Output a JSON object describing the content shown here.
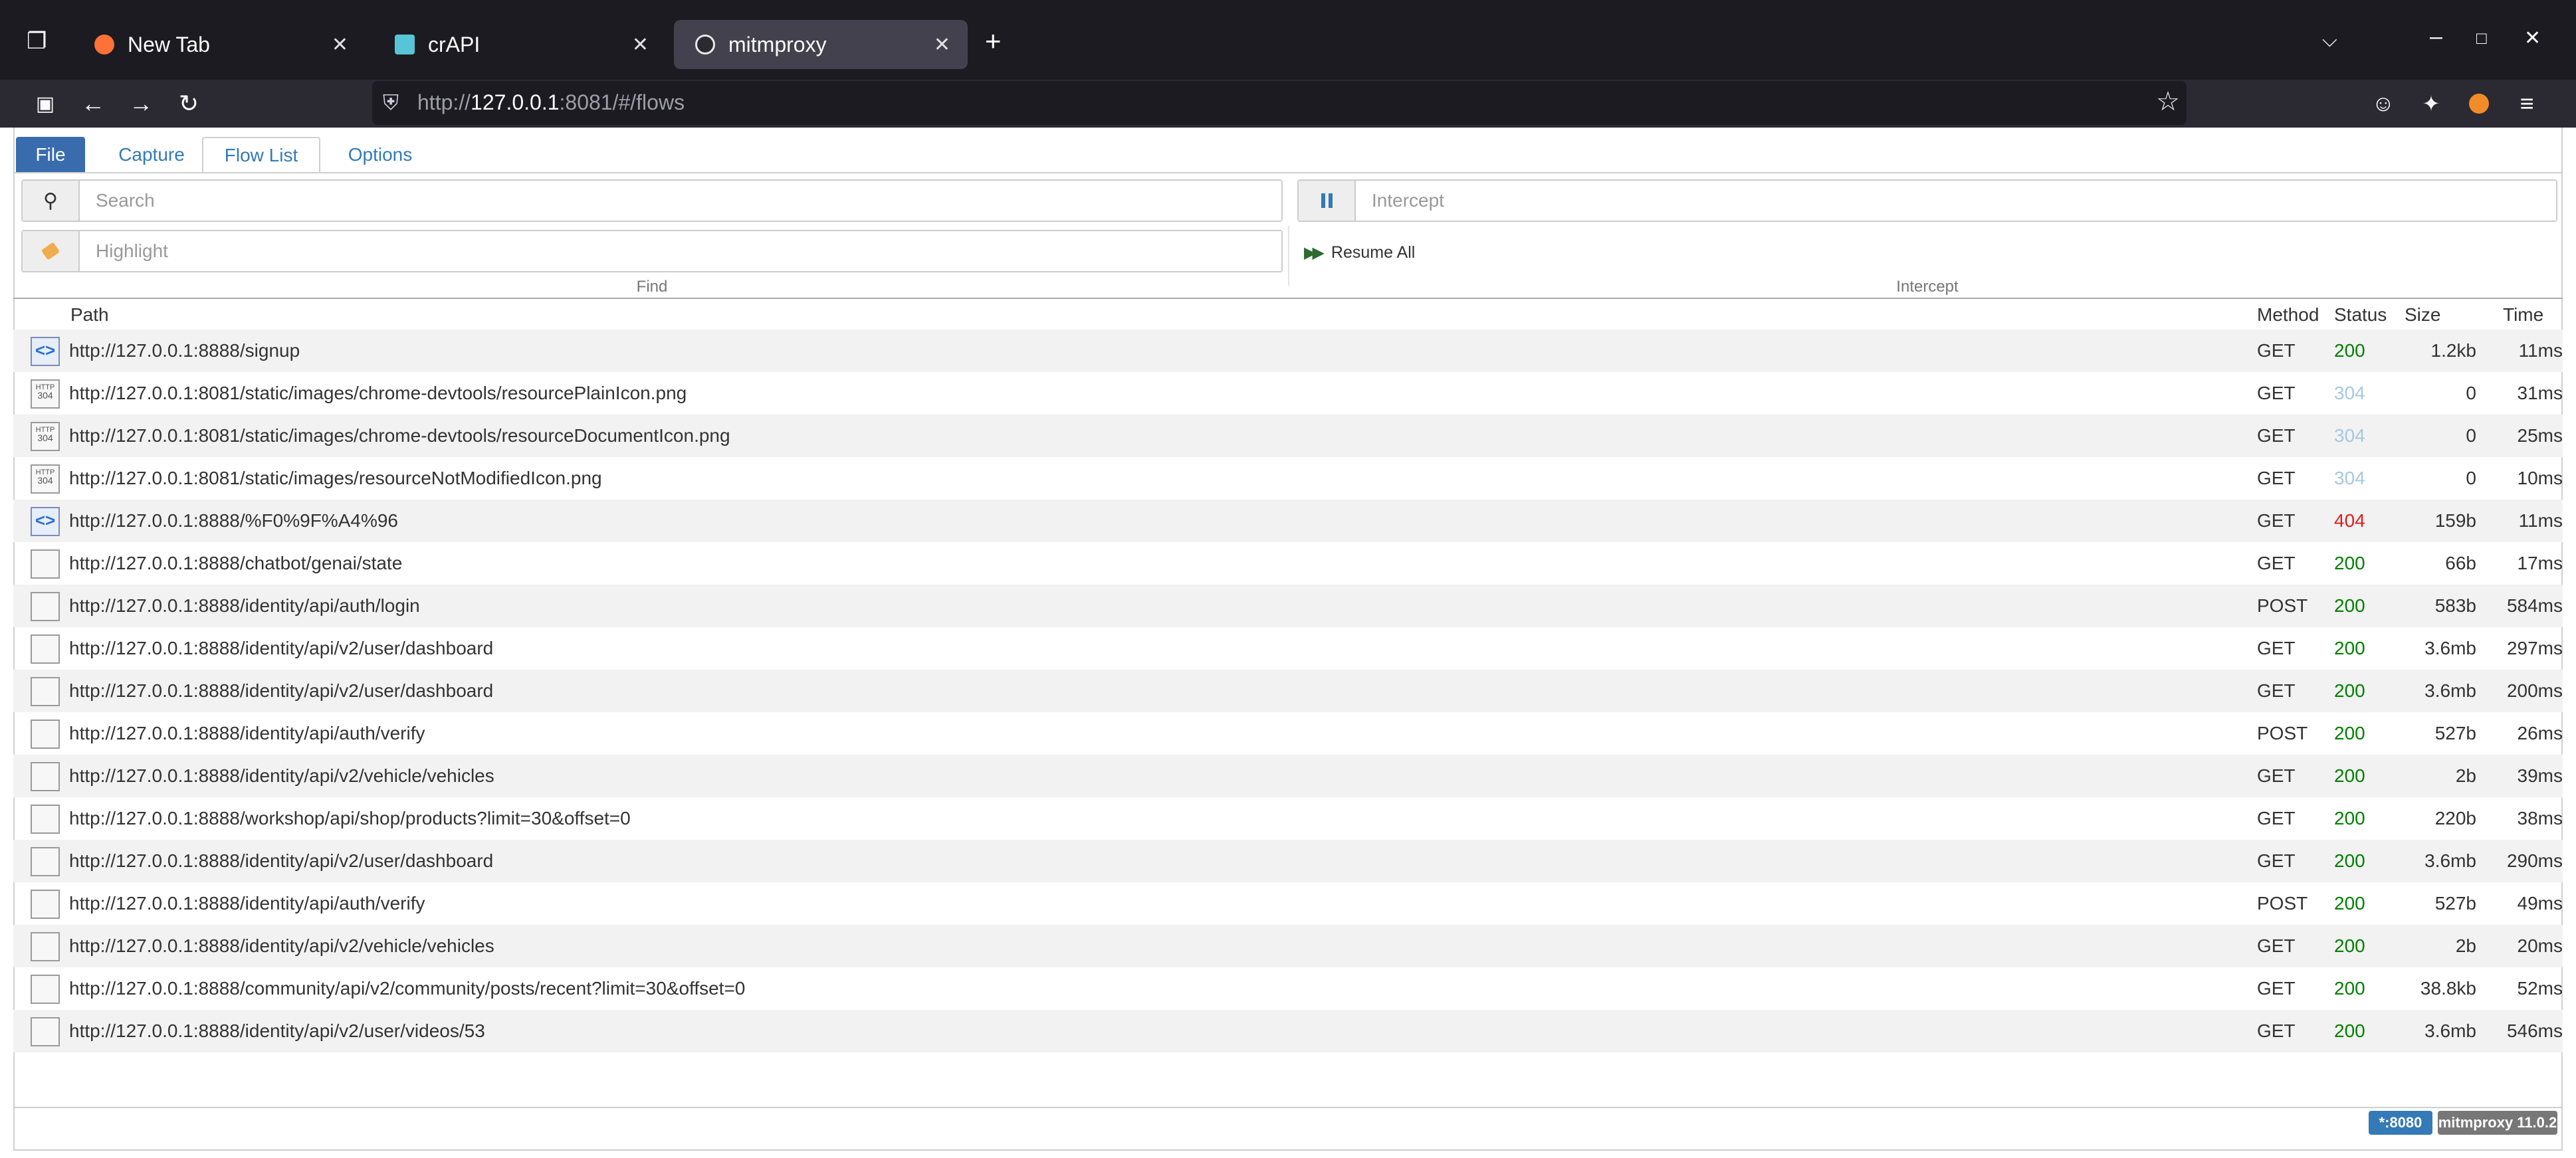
{
  "browser": {
    "tabs": [
      {
        "title": "New Tab",
        "icon": "firefox-icon",
        "color": "#ff7139",
        "active": false
      },
      {
        "title": "crAPI",
        "icon": "crapi-icon",
        "color": "#56c6d6",
        "active": false
      },
      {
        "title": "mitmproxy",
        "icon": "mitmproxy-icon",
        "color": "#e8e8e8",
        "active": true
      }
    ],
    "url_prefix": "http://",
    "url_host": "127.0.0.1",
    "url_rest": ":8081/#/flows"
  },
  "mitm": {
    "menu": [
      "File",
      "Capture",
      "Flow List",
      "Options"
    ],
    "active_menu": "Flow List",
    "search_placeholder": "Search",
    "highlight_placeholder": "Highlight",
    "intercept_placeholder": "Intercept",
    "find_label": "Find",
    "intercept_label": "Intercept",
    "resume_all": "Resume All",
    "columns": {
      "path": "Path",
      "method": "Method",
      "status": "Status",
      "size": "Size",
      "time": "Time"
    },
    "flows": [
      {
        "icon": "doc",
        "path": "http://127.0.0.1:8888/signup",
        "method": "GET",
        "status": "200",
        "size": "1.2kb",
        "time": "11ms"
      },
      {
        "icon": "nm",
        "path": "http://127.0.0.1:8081/static/images/chrome-devtools/resourcePlainIcon.png",
        "method": "GET",
        "status": "304",
        "size": "0",
        "time": "31ms"
      },
      {
        "icon": "nm",
        "path": "http://127.0.0.1:8081/static/images/chrome-devtools/resourceDocumentIcon.png",
        "method": "GET",
        "status": "304",
        "size": "0",
        "time": "25ms"
      },
      {
        "icon": "nm",
        "path": "http://127.0.0.1:8081/static/images/resourceNotModifiedIcon.png",
        "method": "GET",
        "status": "304",
        "size": "0",
        "time": "10ms"
      },
      {
        "icon": "doc",
        "path": "http://127.0.0.1:8888/%F0%9F%A4%96",
        "method": "GET",
        "status": "404",
        "size": "159b",
        "time": "11ms"
      },
      {
        "icon": "plain",
        "path": "http://127.0.0.1:8888/chatbot/genai/state",
        "method": "GET",
        "status": "200",
        "size": "66b",
        "time": "17ms"
      },
      {
        "icon": "plain",
        "path": "http://127.0.0.1:8888/identity/api/auth/login",
        "method": "POST",
        "status": "200",
        "size": "583b",
        "time": "584ms"
      },
      {
        "icon": "plain",
        "path": "http://127.0.0.1:8888/identity/api/v2/user/dashboard",
        "method": "GET",
        "status": "200",
        "size": "3.6mb",
        "time": "297ms"
      },
      {
        "icon": "plain",
        "path": "http://127.0.0.1:8888/identity/api/v2/user/dashboard",
        "method": "GET",
        "status": "200",
        "size": "3.6mb",
        "time": "200ms"
      },
      {
        "icon": "plain",
        "path": "http://127.0.0.1:8888/identity/api/auth/verify",
        "method": "POST",
        "status": "200",
        "size": "527b",
        "time": "26ms"
      },
      {
        "icon": "plain",
        "path": "http://127.0.0.1:8888/identity/api/v2/vehicle/vehicles",
        "method": "GET",
        "status": "200",
        "size": "2b",
        "time": "39ms"
      },
      {
        "icon": "plain",
        "path": "http://127.0.0.1:8888/workshop/api/shop/products?limit=30&offset=0",
        "method": "GET",
        "status": "200",
        "size": "220b",
        "time": "38ms"
      },
      {
        "icon": "plain",
        "path": "http://127.0.0.1:8888/identity/api/v2/user/dashboard",
        "method": "GET",
        "status": "200",
        "size": "3.6mb",
        "time": "290ms"
      },
      {
        "icon": "plain",
        "path": "http://127.0.0.1:8888/identity/api/auth/verify",
        "method": "POST",
        "status": "200",
        "size": "527b",
        "time": "49ms"
      },
      {
        "icon": "plain",
        "path": "http://127.0.0.1:8888/identity/api/v2/vehicle/vehicles",
        "method": "GET",
        "status": "200",
        "size": "2b",
        "time": "20ms"
      },
      {
        "icon": "plain",
        "path": "http://127.0.0.1:8888/community/api/v2/community/posts/recent?limit=30&offset=0",
        "method": "GET",
        "status": "200",
        "size": "38.8kb",
        "time": "52ms"
      },
      {
        "icon": "plain",
        "path": "http://127.0.0.1:8888/identity/api/v2/user/videos/53",
        "method": "GET",
        "status": "200",
        "size": "3.6mb",
        "time": "546ms"
      }
    ],
    "footer": {
      "listen": "*:8080",
      "version": "mitmproxy 11.0.2"
    }
  }
}
